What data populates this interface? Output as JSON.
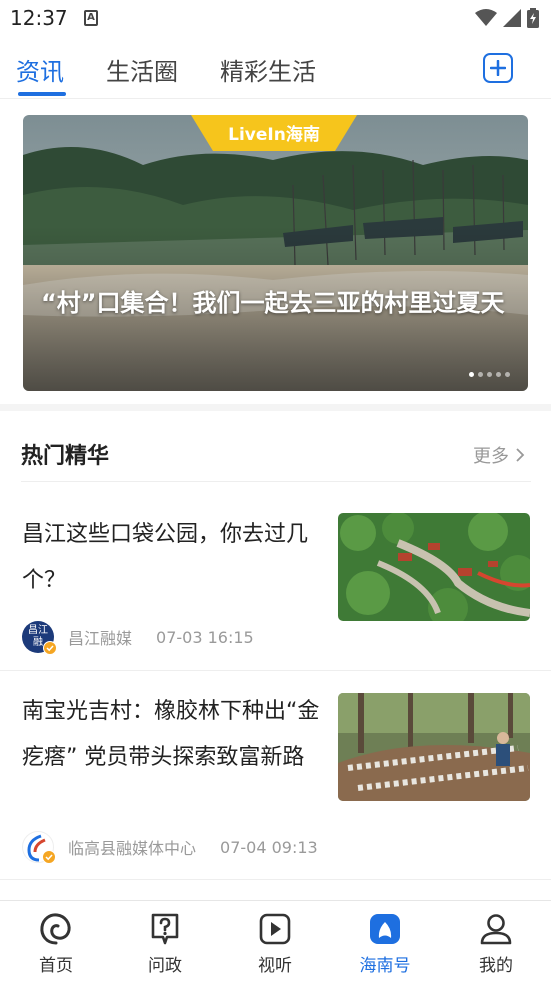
{
  "status_bar": {
    "time": "12:37",
    "a_badge": "A"
  },
  "tabs": [
    {
      "label": "资讯",
      "active": true
    },
    {
      "label": "生活圈",
      "active": false
    },
    {
      "label": "精彩生活",
      "active": false
    }
  ],
  "banner": {
    "badge": "LiveIn海南",
    "title": "“村”口集合！我们一起去三亚的村里过夏天",
    "dot_count": 5,
    "active_dot": 0
  },
  "section": {
    "title": "热门精华",
    "more_label": "更多"
  },
  "articles": [
    {
      "title": "昌江这些口袋公园，你去过几个？",
      "source": "昌江融媒",
      "time": "07-03 16:15",
      "avatar_text": "昌江融"
    },
    {
      "title": "南宝光吉村：橡胶林下种出“金疙瘩” 党员带头探索致富新路",
      "source": "临高县融媒体中心",
      "time": "07-04 09:13"
    }
  ],
  "bottom_nav": [
    {
      "label": "首页",
      "icon": "home-swirl-icon",
      "active": false
    },
    {
      "label": "问政",
      "icon": "question-chat-icon",
      "active": false
    },
    {
      "label": "视听",
      "icon": "play-icon",
      "active": false
    },
    {
      "label": "海南号",
      "icon": "hainan-account-icon",
      "active": true
    },
    {
      "label": "我的",
      "icon": "user-icon",
      "active": false
    }
  ],
  "colors": {
    "accent": "#1e6fe0",
    "muted": "#9a9a9a",
    "verified": "#f5a623"
  }
}
